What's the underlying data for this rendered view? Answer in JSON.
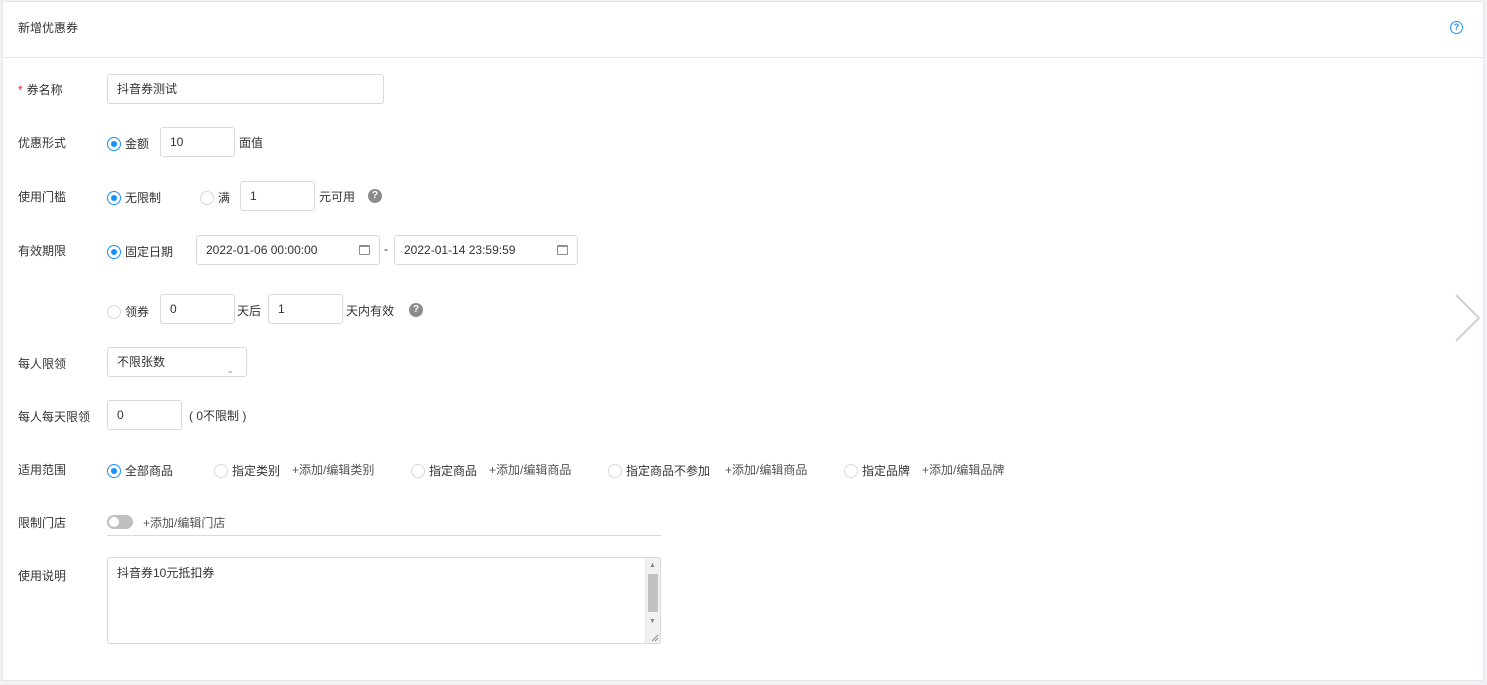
{
  "header": {
    "title": "新增优惠券",
    "help_icon": "question-circle-icon"
  },
  "form": {
    "coupon_name": {
      "label": "券名称",
      "required_mark": "*",
      "value": "抖音券测试"
    },
    "discount_form": {
      "label": "优惠形式",
      "option_label": "金额",
      "value": "10",
      "suffix": "面值",
      "selected": true
    },
    "threshold": {
      "label": "使用门槛",
      "option_unlimited": "无限制",
      "option_full": "满",
      "full_value": "1",
      "suffix": "元可用",
      "selected": "无限制"
    },
    "validity": {
      "label": "有效期限",
      "option_fixed": "固定日期",
      "start_date": "2022-01-06 00:00:00",
      "separator": "-",
      "end_date": "2022-01-14 23:59:59",
      "option_claim": "领券",
      "claim_days_after": "0",
      "days_after_label": "天后",
      "valid_days": "1",
      "valid_days_label": "天内有效",
      "selected": "固定日期"
    },
    "per_person_limit": {
      "label": "每人限领",
      "value": "不限张数"
    },
    "per_person_daily_limit": {
      "label": "每人每天限领",
      "value": "0",
      "hint": "( 0不限制 )"
    },
    "scope": {
      "label": "适用范围",
      "options": [
        {
          "label": "全部商品",
          "selected": true,
          "link": ""
        },
        {
          "label": "指定类别",
          "selected": false,
          "link": "+添加/编辑类别"
        },
        {
          "label": "指定商品",
          "selected": false,
          "link": "+添加/编辑商品"
        },
        {
          "label": "指定商品不参加",
          "selected": false,
          "link": "+添加/编辑商品"
        },
        {
          "label": "指定品牌",
          "selected": false,
          "link": "+添加/编辑品牌"
        }
      ]
    },
    "store_limit": {
      "label": "限制门店",
      "toggle_on": false,
      "link": "+添加/编辑门店"
    },
    "usage_note": {
      "label": "使用说明",
      "value": "抖音券10元抵扣券"
    }
  },
  "colors": {
    "primary": "#1890ff",
    "required": "#f5222d",
    "border": "#d9d9d9"
  }
}
